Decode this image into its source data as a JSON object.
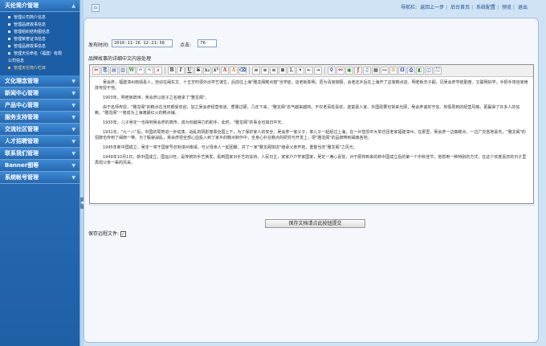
{
  "sidebar": {
    "sections": [
      {
        "label": "天伦简介管理"
      },
      {
        "label": "文化理念管理"
      },
      {
        "label": "新闻中心管理"
      },
      {
        "label": "产品中心管理"
      },
      {
        "label": "服务支持管理"
      },
      {
        "label": "交流社区管理"
      },
      {
        "label": "人才招聘管理"
      },
      {
        "label": "联系我们管理"
      },
      {
        "label": "Banner图等"
      },
      {
        "label": "系统帐号管理"
      }
    ],
    "sub_items": [
      "管理公司简介信息",
      "管理品牌故事信息",
      "管理组织结构图信息",
      "管理荣誉证书信息",
      "管理品牌故事信息",
      "管理天伦命名（福建）有限",
      "公司信息",
      "管理天伦简介栏目"
    ]
  },
  "topnav": {
    "label": "导航栏:",
    "items": [
      "返回上一步",
      "后台首页",
      "系统配置",
      "预览",
      "退出"
    ]
  },
  "form": {
    "time_label": "发布时间:",
    "time_value": "2010-11-26 12:21:38",
    "clicks_label": "点击:",
    "clicks_value": "76",
    "content_label": "品牌故事的详细中文内容处理",
    "save_remote_label": "保存远程文件:",
    "save_remote_checked": "✓",
    "submit_label": "保存文档请点此按钮提交"
  },
  "editor": {
    "paragraphs": [
      "吴会彦，福建漳州南靖县人，自幼在闽东文、十五岁时便外出学艺谋生，后前往上海\"雅龙阁糕点馆\"当学徒，店老板陈明，原为清宫御厨，会老还乡后在上海开了这家糕点店。明老板无子嗣，见吴会彦学徒勤奋，又聪明好学，手把手将自家绝技传授于他。",
      "1903年，明老板辞世，吴会彦以徒子之名继承了\"雅龙阁\"。",
      "由于名师传授，\"雅龙阁\"的糕点在当时颇受欢迎，加之吴会彦经营有道、质量过硬，几年下来，\"雅龙阁\"名气越来越响，不仅老百姓喜欢，连富豪人家、外国政要也常来光顾，吴会彦诚实守信、热情周到的经营风格，更赢得了许多人的信赖。\"雅龙阁\"一度成为上海滩最红火的糕点铺。",
      "1930年，儿子吴定一也得到吴会彦的真传，成为他最得力的助手，此时，\"雅龙阁\"的事业也如日中天。",
      "1931年，\"九一八\"后，中国的局势进一步动荡，战乱的阴影笼罩全国上下，为了保护家人的安全，吴会彦一家父子，率儿子一起经过上海，在一片惶恐中大举迁回老家福建漳州，在那里，吴会彦一边做糕点，一边广交各地豪杰，\"雅龙阁\"的招牌也传到了闽南一带。为了躲避战乱，吴会彦把全部心血投入到了家乡的糕点制作中，全身心扑在糕点的研究与开发上，把\"雅龙阁\"的品牌带到闽南各地。",
      "1945年新中国成立，吴定一将于国家号召到漳州南靖，与父母亲人一起团聚，并了一家\"雅龙阁饼店\"继承父亲开拓，重整当年\"雅龙阁\"之风光。",
      "1949年10月1日，新中国成立，国运兴旺，是传统的手艺焕发。看到国家对手艺的扶持，人民日主，家家户户学家国家，吴定一满心喜悦，对于即将到来的新中国成立后的第一个中秋佳节，他想用一种特别的方式，在这个欢度喜庆的日子里再现父亲一辈的风采。"
    ]
  }
}
